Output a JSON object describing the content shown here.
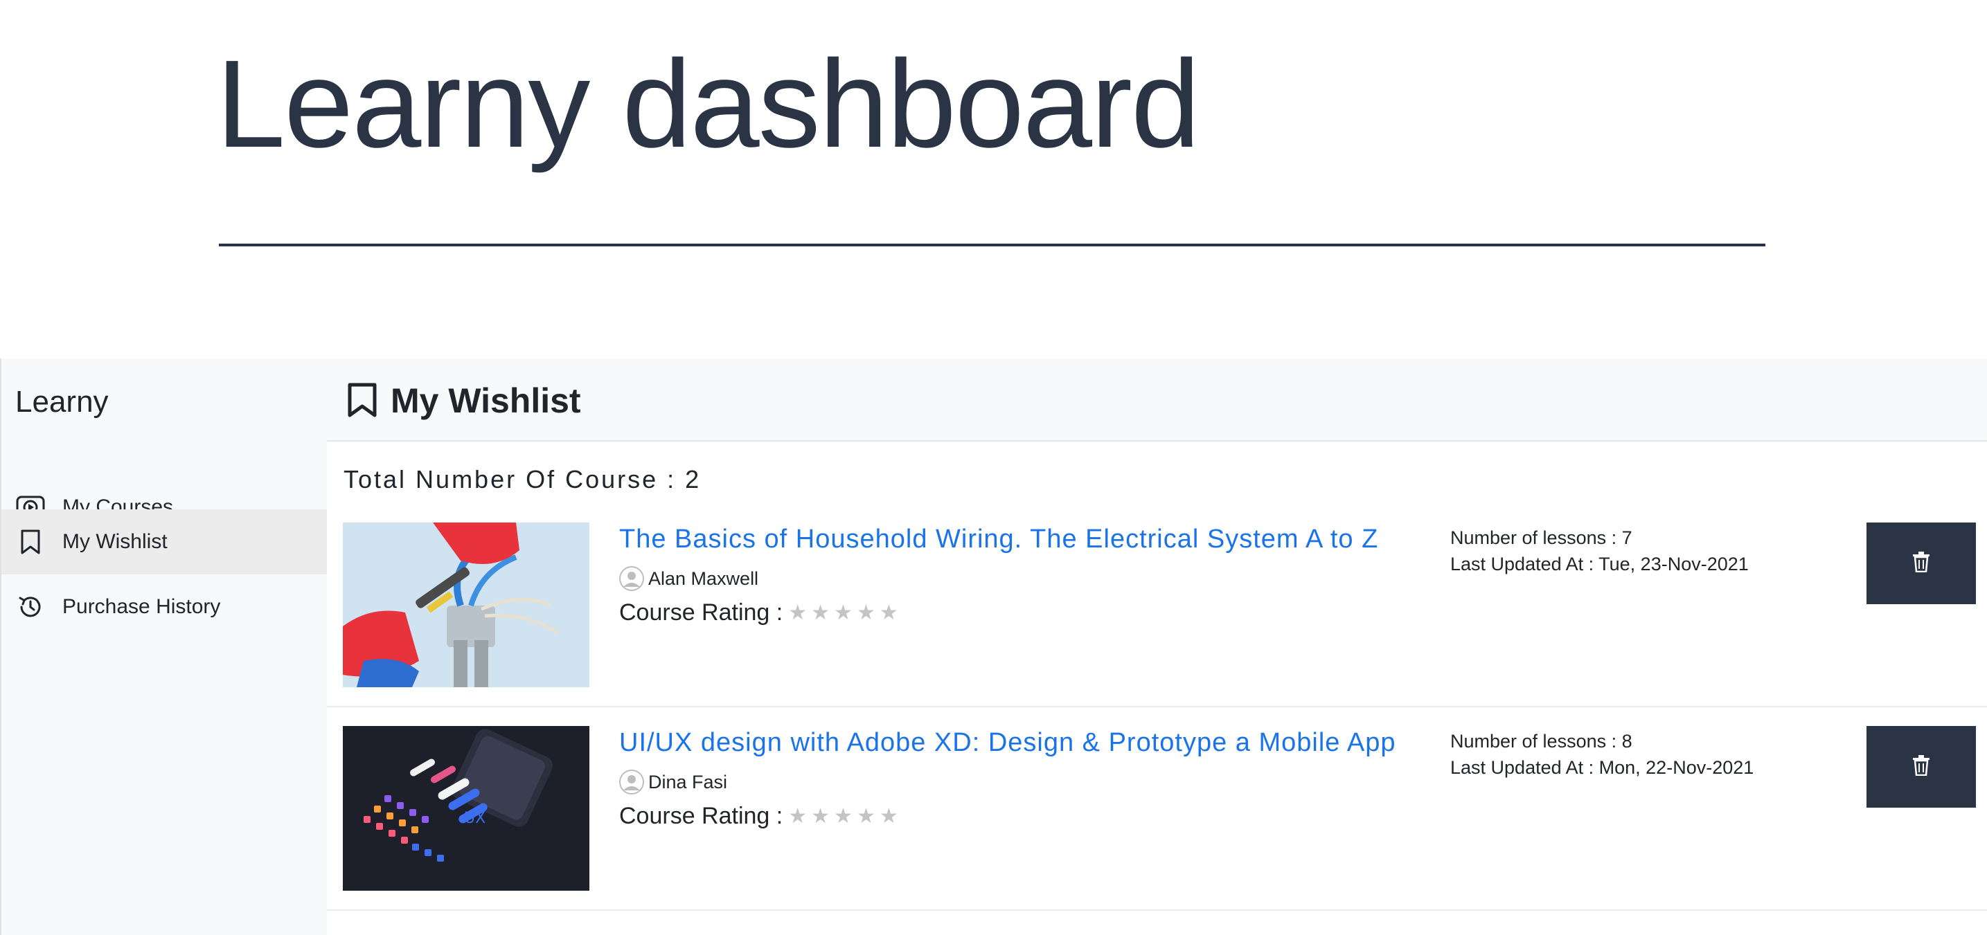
{
  "hero": {
    "title": "Learny dashboard"
  },
  "sidebar": {
    "brand": "Learny",
    "items": [
      {
        "label": "My Courses",
        "icon": "play-circle-icon"
      },
      {
        "label": "My Wishlist",
        "icon": "bookmark-icon",
        "active": true
      },
      {
        "label": "Purchase History",
        "icon": "history-icon"
      }
    ]
  },
  "main": {
    "header_title": "My Wishlist",
    "header_icon": "bookmark-icon",
    "total_label": "Total Number Of Course : 2",
    "courses": [
      {
        "title": "The Basics of Household Wiring. The Electrical System A to Z",
        "author": "Alan Maxwell",
        "rating_label": "Course Rating :",
        "rating": 0,
        "lessons": "Number of lessons : 7",
        "updated": "Last Updated At : Tue, 23-Nov-2021"
      },
      {
        "title": "UI/UX design with Adobe XD: Design & Prototype a Mobile App",
        "author": "Dina Fasi",
        "rating_label": "Course Rating :",
        "rating": 0,
        "lessons": "Number of lessons : 8",
        "updated": "Last Updated At : Mon, 22-Nov-2021"
      }
    ]
  },
  "colors": {
    "dark": "#2b3445",
    "link": "#1a73e8",
    "sidebar_bg": "#f8f9fa",
    "active_bg": "#ececec",
    "star": "#c4c4c4"
  }
}
